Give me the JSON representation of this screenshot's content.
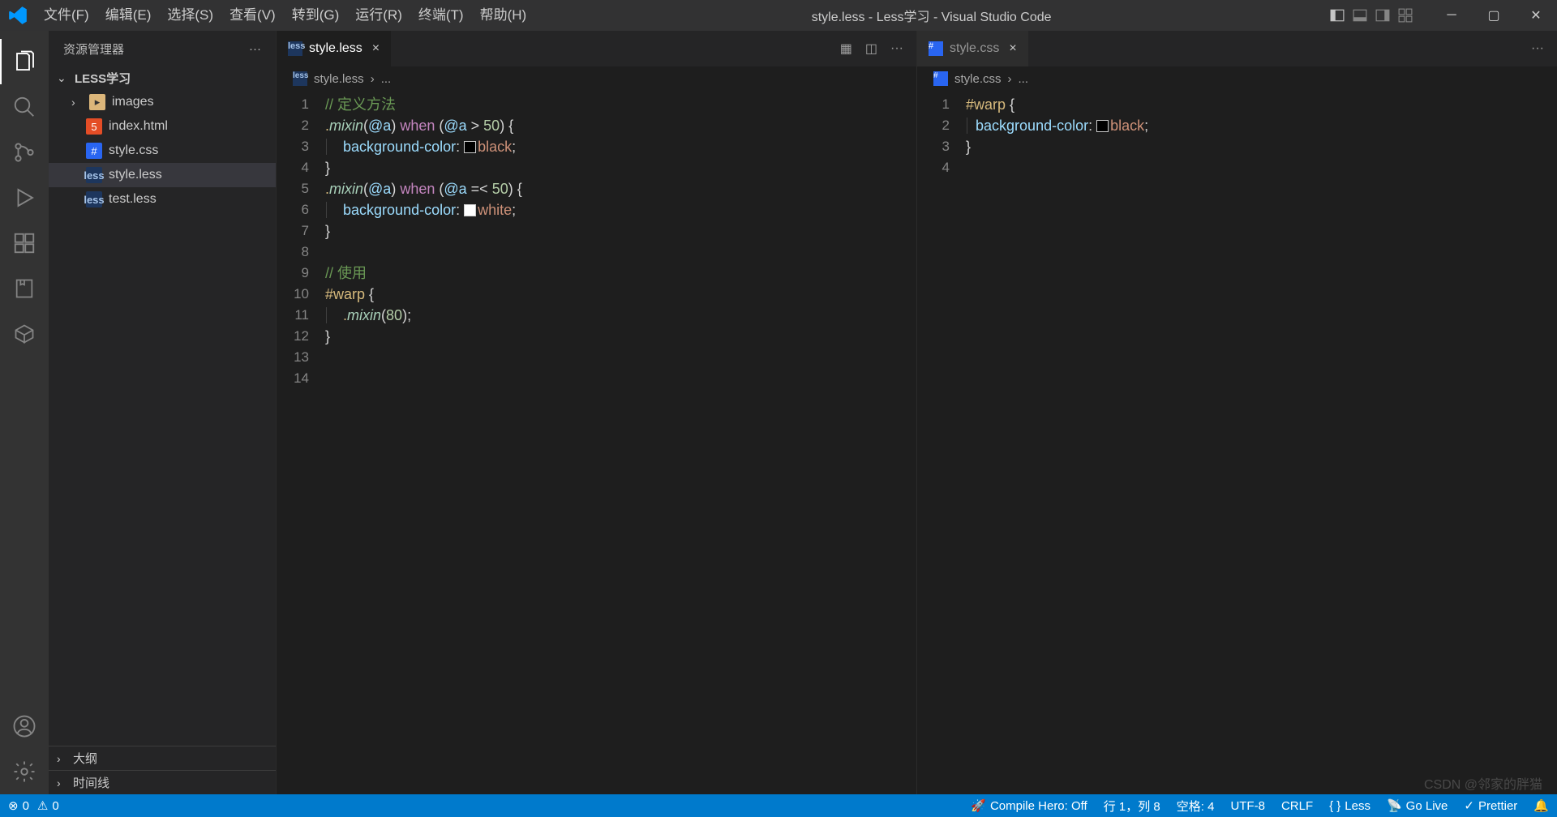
{
  "title": "style.less - Less学习 - Visual Studio Code",
  "menu": [
    "文件(F)",
    "编辑(E)",
    "选择(S)",
    "查看(V)",
    "转到(G)",
    "运行(R)",
    "终端(T)",
    "帮助(H)"
  ],
  "sidebar": {
    "header": "资源管理器",
    "project": "LESS学习",
    "items": [
      {
        "type": "folder",
        "name": "images"
      },
      {
        "type": "html",
        "name": "index.html"
      },
      {
        "type": "css",
        "name": "style.css"
      },
      {
        "type": "less",
        "name": "style.less",
        "active": true
      },
      {
        "type": "less",
        "name": "test.less"
      }
    ],
    "sections": [
      "大纲",
      "时间线"
    ]
  },
  "panes": [
    {
      "tab": {
        "icon": "less",
        "name": "style.less",
        "close": true,
        "active": true
      },
      "breadcrumb": [
        "style.less",
        "..."
      ],
      "lines": 14,
      "code": [
        [
          {
            "t": "comment",
            "v": "// 定义方法"
          }
        ],
        [
          {
            "t": "sel",
            "v": "."
          },
          {
            "t": "func",
            "v": "mixin"
          },
          {
            "t": "punct",
            "v": "("
          },
          {
            "t": "var",
            "v": "@a"
          },
          {
            "t": "punct",
            "v": ") "
          },
          {
            "t": "keyword",
            "v": "when"
          },
          {
            "t": "punct",
            "v": " ("
          },
          {
            "t": "var",
            "v": "@a"
          },
          {
            "t": "punct",
            "v": " > "
          },
          {
            "t": "num",
            "v": "50"
          },
          {
            "t": "punct",
            "v": ") {"
          }
        ],
        [
          {
            "t": "indent",
            "v": "    "
          },
          {
            "t": "prop",
            "v": "background-color"
          },
          {
            "t": "punct",
            "v": ": "
          },
          {
            "t": "colorbox",
            "v": "#000"
          },
          {
            "t": "value",
            "v": "black"
          },
          {
            "t": "punct",
            "v": ";"
          }
        ],
        [
          {
            "t": "punct",
            "v": "}"
          }
        ],
        [
          {
            "t": "sel",
            "v": "."
          },
          {
            "t": "func",
            "v": "mixin"
          },
          {
            "t": "punct",
            "v": "("
          },
          {
            "t": "var",
            "v": "@a"
          },
          {
            "t": "punct",
            "v": ") "
          },
          {
            "t": "keyword",
            "v": "when"
          },
          {
            "t": "punct",
            "v": " ("
          },
          {
            "t": "var",
            "v": "@a"
          },
          {
            "t": "punct",
            "v": " =< "
          },
          {
            "t": "num",
            "v": "50"
          },
          {
            "t": "punct",
            "v": ") {"
          }
        ],
        [
          {
            "t": "indent",
            "v": "    "
          },
          {
            "t": "prop",
            "v": "background-color"
          },
          {
            "t": "punct",
            "v": ": "
          },
          {
            "t": "colorbox",
            "v": "#fff"
          },
          {
            "t": "value",
            "v": "white"
          },
          {
            "t": "punct",
            "v": ";"
          }
        ],
        [
          {
            "t": "punct",
            "v": "}"
          }
        ],
        [],
        [
          {
            "t": "comment",
            "v": "// 使用"
          }
        ],
        [
          {
            "t": "id",
            "v": "#warp"
          },
          {
            "t": "punct",
            "v": " {"
          }
        ],
        [
          {
            "t": "indent",
            "v": "    "
          },
          {
            "t": "sel",
            "v": "."
          },
          {
            "t": "func",
            "v": "mixin"
          },
          {
            "t": "punct",
            "v": "("
          },
          {
            "t": "num",
            "v": "80"
          },
          {
            "t": "punct",
            "v": ");"
          }
        ],
        [
          {
            "t": "punct",
            "v": "}"
          }
        ],
        [],
        []
      ]
    },
    {
      "tab": {
        "icon": "css",
        "name": "style.css",
        "close": true,
        "active": false
      },
      "breadcrumb": [
        "style.css",
        "..."
      ],
      "lines": 4,
      "code": [
        [
          {
            "t": "id",
            "v": "#warp"
          },
          {
            "t": "punct",
            "v": " {"
          }
        ],
        [
          {
            "t": "indent",
            "v": "  "
          },
          {
            "t": "prop",
            "v": "background-color"
          },
          {
            "t": "punct",
            "v": ": "
          },
          {
            "t": "colorbox",
            "v": "#000"
          },
          {
            "t": "value",
            "v": "black"
          },
          {
            "t": "punct",
            "v": ";"
          }
        ],
        [
          {
            "t": "punct",
            "v": "}"
          }
        ],
        []
      ]
    }
  ],
  "status": {
    "errors": "0",
    "warnings": "0",
    "compileHero": "Compile Hero: Off",
    "pos": "行 1，列 8",
    "spaces": "空格: 4",
    "encoding": "UTF-8",
    "eol": "CRLF",
    "lang": "Less",
    "goLive": "Go Live",
    "prettier": "Prettier"
  },
  "watermark": "CSDN @邻家的胖猫"
}
